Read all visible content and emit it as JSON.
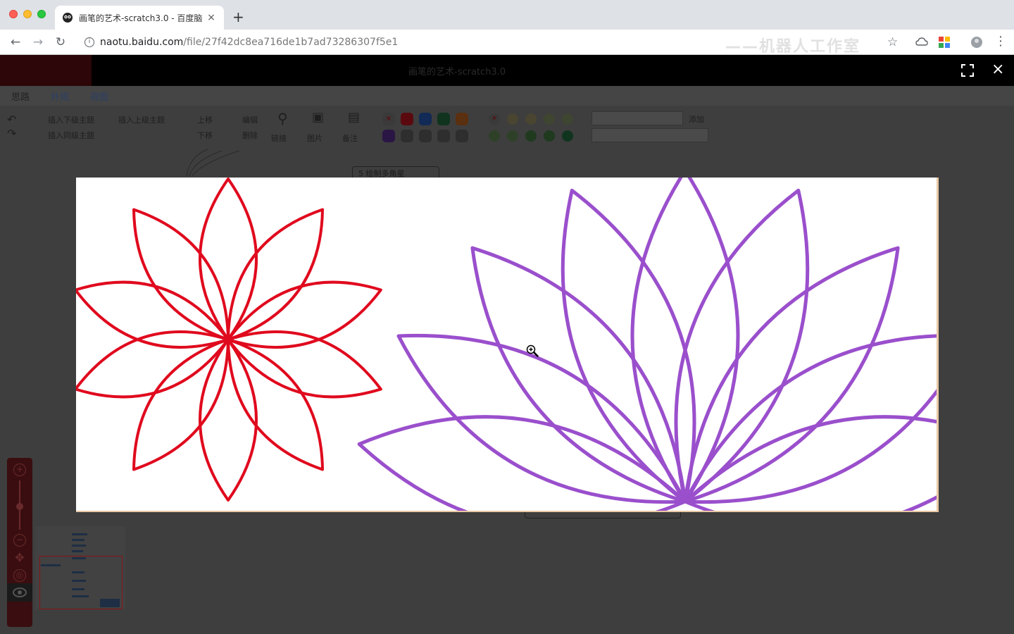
{
  "browser": {
    "tab_title": "画笔的艺术-scratch3.0 - 百度脑",
    "tab_close": "×",
    "new_tab": "+",
    "url_host": "naotu.baidu.com",
    "url_path": "/file/27f42dc8ea716de1b7ad73286307f5e1",
    "watermark": "——机器人工作室"
  },
  "viewer": {
    "title": "画笔的艺术-scratch3.0",
    "close": "×"
  },
  "menu": {
    "tabs": [
      "思路",
      "外观",
      "视图"
    ]
  },
  "ribbon": {
    "insert_child": "插入下级主题",
    "insert_parent": "插入上级主题",
    "insert_sibling": "插入同级主题",
    "move_up": "上移",
    "move_down": "下移",
    "edit": "编辑",
    "delete": "删除",
    "link": "链接",
    "image": "图片",
    "note": "备注",
    "tag_add": "添加",
    "priorities": [
      "1",
      "2",
      "3",
      "4",
      "5",
      "6",
      "7",
      "8",
      "9"
    ]
  },
  "background_node": {
    "label": "5 绘制多角星"
  },
  "colors": {
    "flower_left": "#e00a1e",
    "flower_right": "#9a4fcc",
    "accent_dark": "#3a0e10"
  },
  "icons": {
    "cursor": "zoom-in-cursor-icon"
  }
}
